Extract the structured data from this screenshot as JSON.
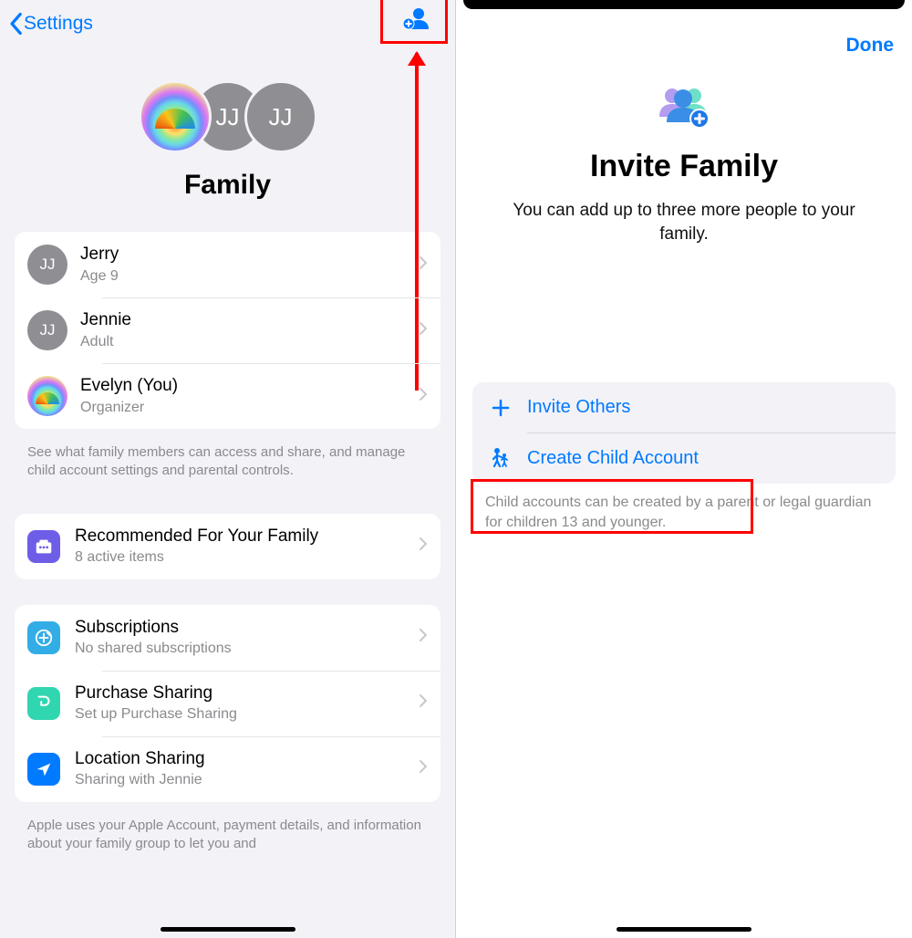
{
  "left": {
    "back_label": "Settings",
    "title": "Family",
    "avatar_stack": [
      {
        "type": "rainbow"
      },
      {
        "type": "initials",
        "text": "JJ"
      },
      {
        "type": "initials",
        "text": "JJ"
      }
    ],
    "members": [
      {
        "avatar_type": "initials",
        "avatar_text": "JJ",
        "name": "Jerry",
        "detail": "Age 9"
      },
      {
        "avatar_type": "initials",
        "avatar_text": "JJ",
        "name": "Jennie",
        "detail": "Adult"
      },
      {
        "avatar_type": "rainbow",
        "avatar_text": "",
        "name": "Evelyn (You)",
        "detail": "Organizer"
      }
    ],
    "members_footer": "See what family members can access and share, and manage child account settings and parental controls.",
    "recommended": {
      "title": "Recommended For Your Family",
      "detail": "8 active items"
    },
    "sharing": [
      {
        "icon": "subscriptions",
        "title": "Subscriptions",
        "detail": "No shared subscriptions"
      },
      {
        "icon": "purchase",
        "title": "Purchase Sharing",
        "detail": "Set up Purchase Sharing"
      },
      {
        "icon": "location",
        "title": "Location Sharing",
        "detail": "Sharing with Jennie"
      }
    ],
    "sharing_footer": "Apple uses your Apple Account, payment details, and information about your family group to let you and"
  },
  "right": {
    "done_label": "Done",
    "title": "Invite Family",
    "subtitle": "You can add up to three more people to your family.",
    "options": [
      {
        "key": "invite",
        "icon": "plus",
        "label": "Invite Others"
      },
      {
        "key": "child",
        "icon": "child-figure",
        "label": "Create Child Account"
      }
    ],
    "options_footer": "Child accounts can be created by a parent or legal guardian for children 13 and younger."
  }
}
